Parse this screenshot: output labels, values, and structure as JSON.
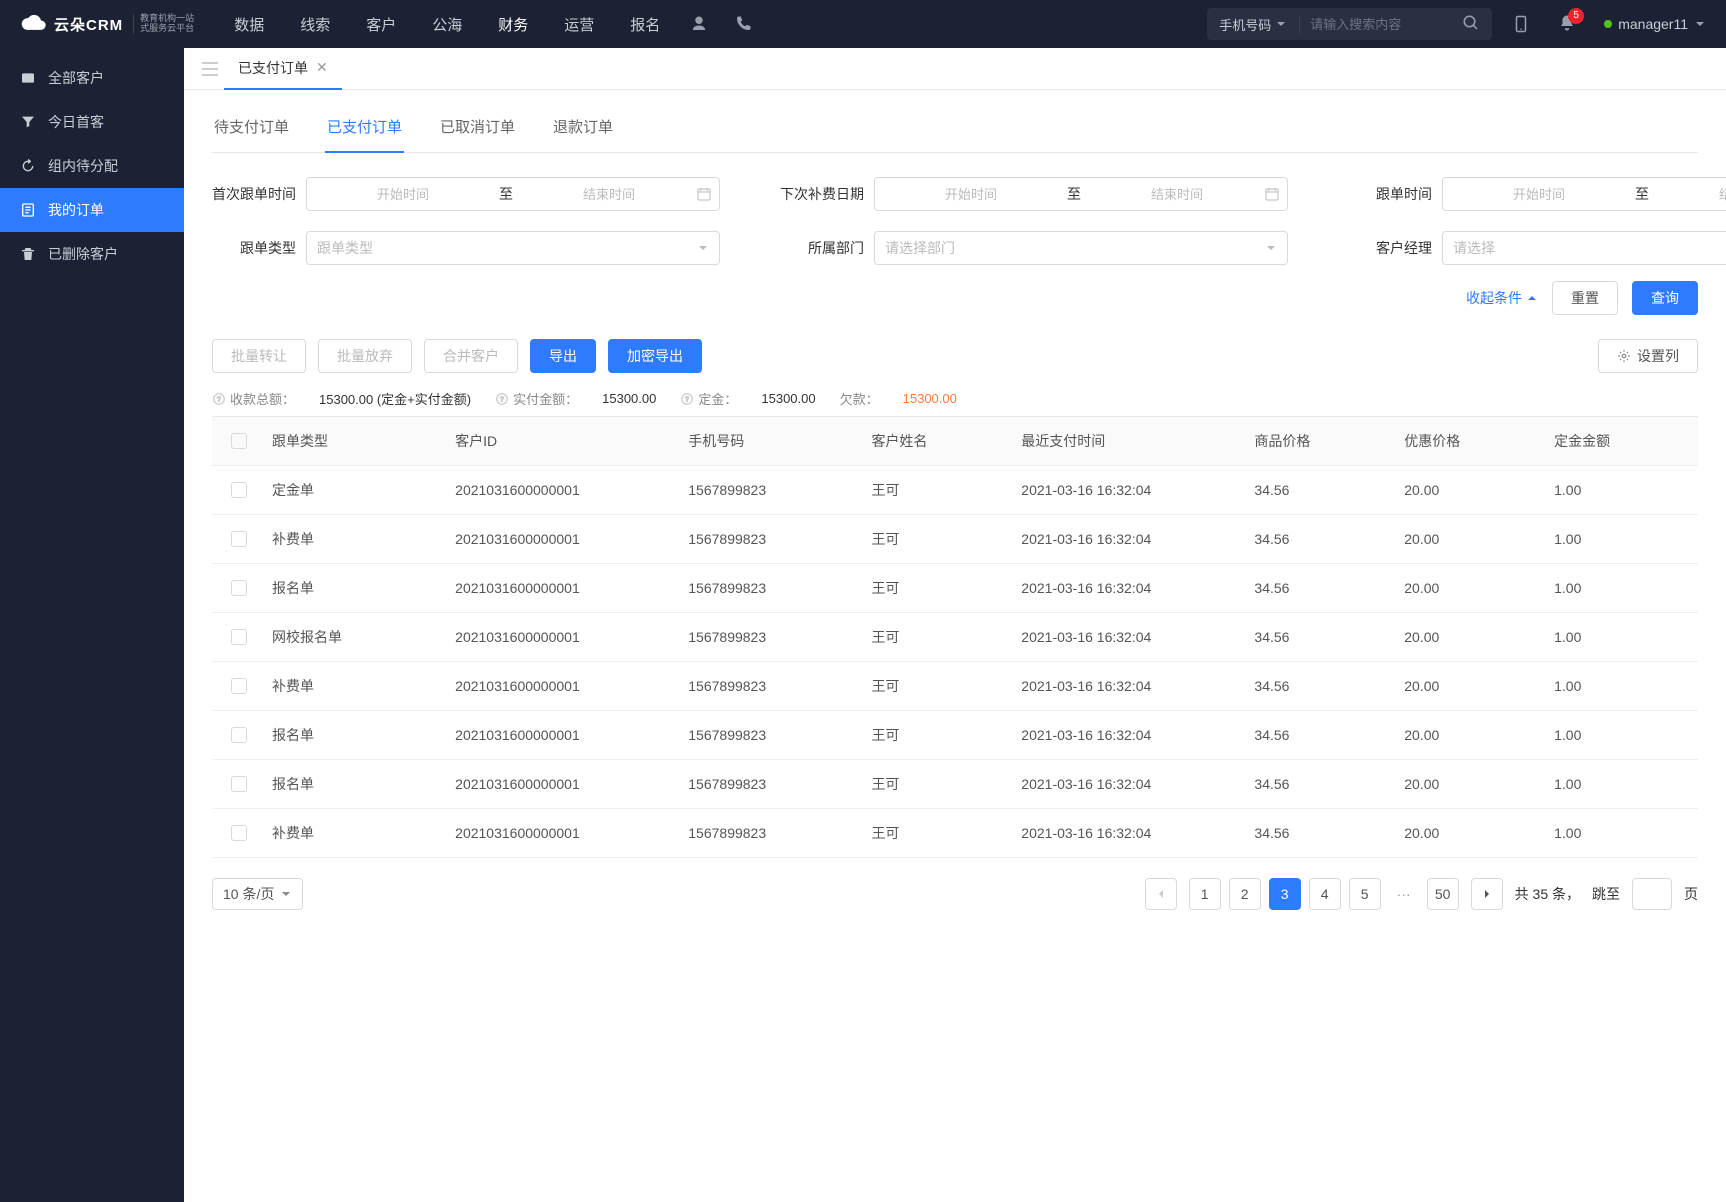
{
  "brand": {
    "name": "云朵CRM",
    "sub1": "教育机构一站",
    "sub2": "式服务云平台"
  },
  "topnav": {
    "items": [
      "数据",
      "线索",
      "客户",
      "公海",
      "财务",
      "运营",
      "报名"
    ],
    "active_index": 4,
    "search_type": "手机号码",
    "search_placeholder": "请输入搜索内容",
    "badge_count": "5",
    "username": "manager11"
  },
  "sidebar": {
    "items": [
      {
        "label": "全部客户",
        "icon": "users"
      },
      {
        "label": "今日首客",
        "icon": "funnel"
      },
      {
        "label": "组内待分配",
        "icon": "refresh"
      },
      {
        "label": "我的订单",
        "icon": "order"
      },
      {
        "label": "已删除客户",
        "icon": "trash"
      }
    ],
    "active_index": 3
  },
  "wtab": {
    "label": "已支付订单"
  },
  "subtabs": {
    "items": [
      "待支付订单",
      "已支付订单",
      "已取消订单",
      "退款订单"
    ],
    "active_index": 1
  },
  "filters": {
    "first_follow": {
      "label": "首次跟单时间",
      "start_ph": "开始时间",
      "sep": "至",
      "end_ph": "结束时间"
    },
    "next_renew": {
      "label": "下次补费日期",
      "start_ph": "开始时间",
      "sep": "至",
      "end_ph": "结束时间"
    },
    "follow_time": {
      "label": "跟单时间",
      "start_ph": "开始时间",
      "sep": "至",
      "end_ph": "结束时间"
    },
    "follow_type": {
      "label": "跟单类型",
      "placeholder": "跟单类型"
    },
    "dept": {
      "label": "所属部门",
      "placeholder": "请选择部门"
    },
    "manager": {
      "label": "客户经理",
      "placeholder": "请选择"
    },
    "collapse": "收起条件",
    "reset": "重置",
    "query": "查询"
  },
  "actions": {
    "batch_transfer": "批量转让",
    "batch_abandon": "批量放弃",
    "merge": "合并客户",
    "export": "导出",
    "encrypt_export": "加密导出",
    "set_columns": "设置列"
  },
  "summary": {
    "total_label": "收款总额：",
    "total_value": "15300.00 (定金+实付金额)",
    "paid_label": "实付金额：",
    "paid_value": "15300.00",
    "deposit_label": "定金：",
    "deposit_value": "15300.00",
    "owe_label": "欠款：",
    "owe_value": "15300.00"
  },
  "table": {
    "headers": [
      "跟单类型",
      "客户ID",
      "手机号码",
      "客户姓名",
      "最近支付时间",
      "商品价格",
      "优惠价格",
      "定金金额"
    ],
    "rows": [
      {
        "type": "定金单",
        "cid": "2021031600000001",
        "phone": "1567899823",
        "name": "王可",
        "time": "2021-03-16 16:32:04",
        "price": "34.56",
        "discount": "20.00",
        "deposit": "1.00"
      },
      {
        "type": "补费单",
        "cid": "2021031600000001",
        "phone": "1567899823",
        "name": "王可",
        "time": "2021-03-16 16:32:04",
        "price": "34.56",
        "discount": "20.00",
        "deposit": "1.00"
      },
      {
        "type": "报名单",
        "cid": "2021031600000001",
        "phone": "1567899823",
        "name": "王可",
        "time": "2021-03-16 16:32:04",
        "price": "34.56",
        "discount": "20.00",
        "deposit": "1.00"
      },
      {
        "type": "网校报名单",
        "cid": "2021031600000001",
        "phone": "1567899823",
        "name": "王可",
        "time": "2021-03-16 16:32:04",
        "price": "34.56",
        "discount": "20.00",
        "deposit": "1.00"
      },
      {
        "type": "补费单",
        "cid": "2021031600000001",
        "phone": "1567899823",
        "name": "王可",
        "time": "2021-03-16 16:32:04",
        "price": "34.56",
        "discount": "20.00",
        "deposit": "1.00"
      },
      {
        "type": "报名单",
        "cid": "2021031600000001",
        "phone": "1567899823",
        "name": "王可",
        "time": "2021-03-16 16:32:04",
        "price": "34.56",
        "discount": "20.00",
        "deposit": "1.00"
      },
      {
        "type": "报名单",
        "cid": "2021031600000001",
        "phone": "1567899823",
        "name": "王可",
        "time": "2021-03-16 16:32:04",
        "price": "34.56",
        "discount": "20.00",
        "deposit": "1.00"
      },
      {
        "type": "补费单",
        "cid": "2021031600000001",
        "phone": "1567899823",
        "name": "王可",
        "time": "2021-03-16 16:32:04",
        "price": "34.56",
        "discount": "20.00",
        "deposit": "1.00"
      }
    ]
  },
  "pager": {
    "page_size": "10 条/页",
    "pages": [
      "1",
      "2",
      "3",
      "4",
      "5"
    ],
    "active_page": "3",
    "last_page": "50",
    "total_prefix": "共 ",
    "total_count": "35",
    "total_suffix": " 条，",
    "jump_label": "跳至",
    "page_unit": "页"
  }
}
